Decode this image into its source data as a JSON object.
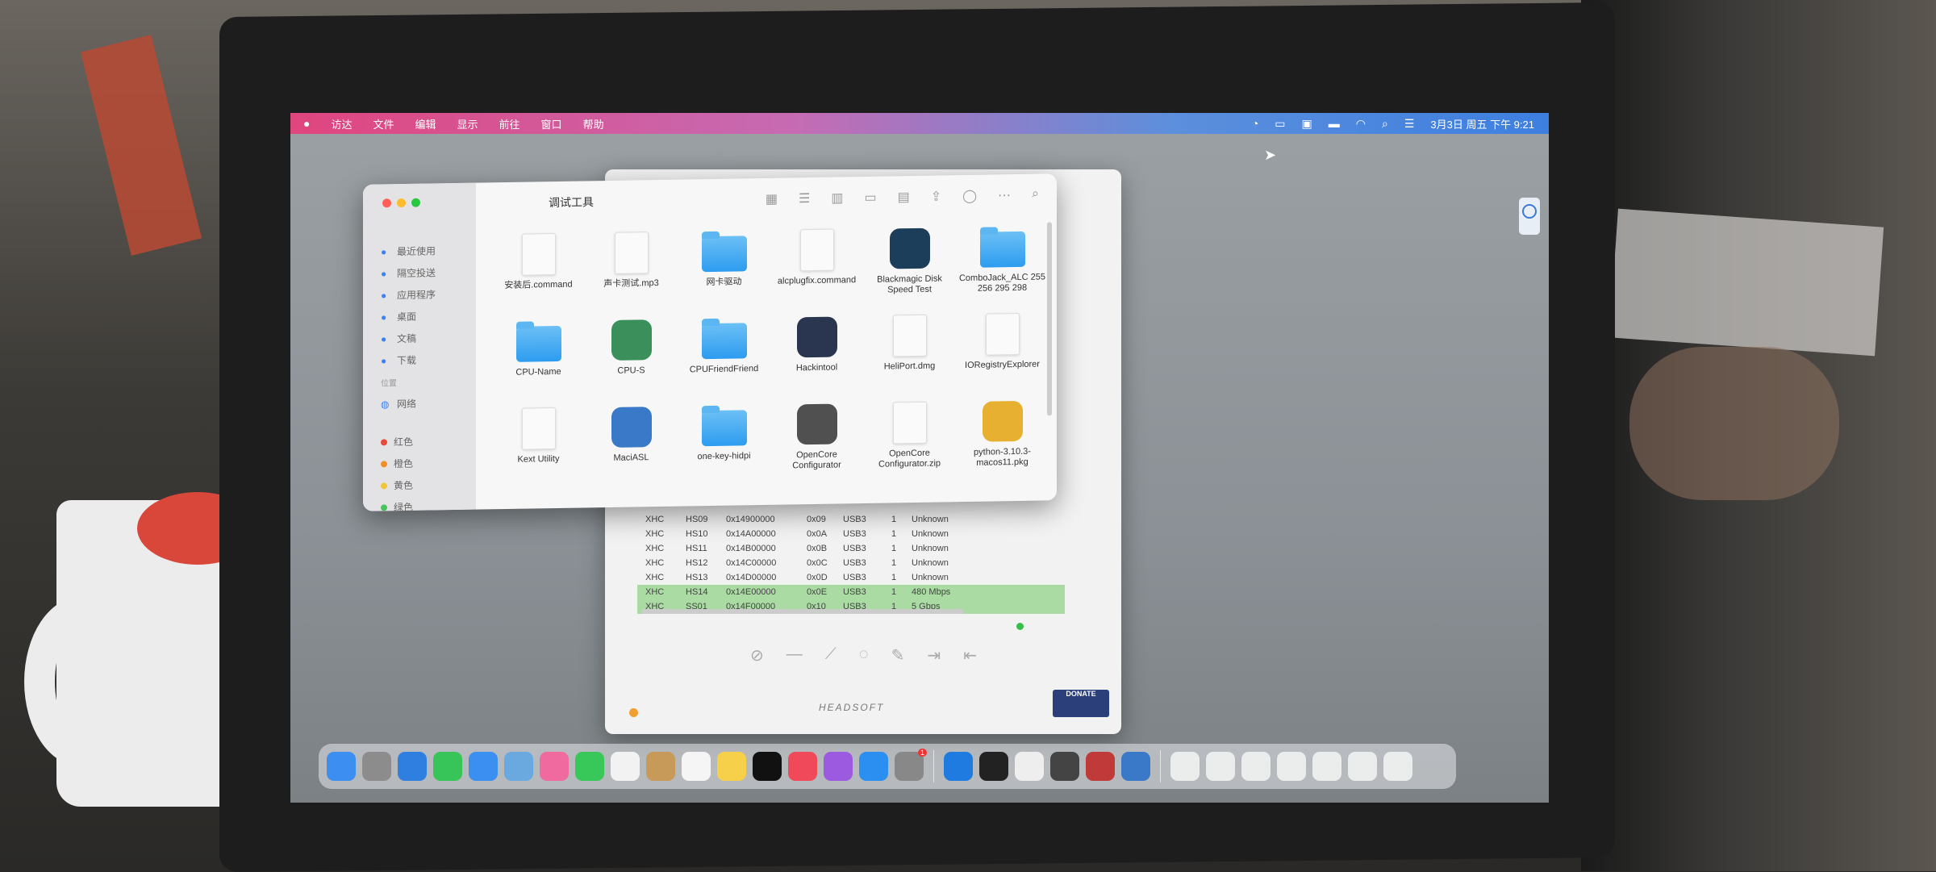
{
  "menubar": {
    "apple": "",
    "items": [
      "访达",
      "文件",
      "编辑",
      "显示",
      "前往",
      "窗口",
      "帮助"
    ],
    "clock": "3月3日 周五 下午 9:21"
  },
  "finder": {
    "title": "调试工具",
    "sidebar": [
      {
        "label": "最近使用",
        "icon": "clock-icon"
      },
      {
        "label": "隔空投送",
        "icon": "airdrop-icon"
      },
      {
        "label": "应用程序",
        "icon": "apps-icon"
      },
      {
        "label": "桌面",
        "icon": "desktop-icon"
      },
      {
        "label": "文稿",
        "icon": "doc-icon"
      },
      {
        "label": "下载",
        "icon": "download-icon"
      }
    ],
    "sidebar_section_location": "位置",
    "sidebar_network": "网络",
    "sidebar_tags": [
      {
        "label": "红色",
        "color": "#e64a3b"
      },
      {
        "label": "橙色",
        "color": "#f0902a"
      },
      {
        "label": "黄色",
        "color": "#f0c53a"
      },
      {
        "label": "绿色",
        "color": "#48c45a"
      }
    ],
    "files": [
      {
        "name": "安装后.command",
        "kind": "doc"
      },
      {
        "name": "声卡测试.mp3",
        "kind": "doc"
      },
      {
        "name": "网卡驱动",
        "kind": "folder"
      },
      {
        "name": "alcplugfix.command",
        "kind": "doc"
      },
      {
        "name": "Blackmagic Disk Speed Test",
        "kind": "app",
        "color": "#1d3e5a"
      },
      {
        "name": "ComboJack_ALC 255 256 295 298",
        "kind": "folder"
      },
      {
        "name": "CPU-Name",
        "kind": "folder"
      },
      {
        "name": "CPU-S",
        "kind": "app",
        "color": "#3a8f5a"
      },
      {
        "name": "CPUFriendFriend",
        "kind": "folder"
      },
      {
        "name": "Hackintool",
        "kind": "app",
        "color": "#2a3550"
      },
      {
        "name": "HeliPort.dmg",
        "kind": "doc"
      },
      {
        "name": "IORegistryExplorer",
        "kind": "doc"
      },
      {
        "name": "Kext Utility",
        "kind": "doc"
      },
      {
        "name": "MaciASL",
        "kind": "app",
        "color": "#3a78c8"
      },
      {
        "name": "one-key-hidpi",
        "kind": "folder"
      },
      {
        "name": "OpenCore Configurator",
        "kind": "app",
        "color": "#505050"
      },
      {
        "name": "OpenCore Configurator.zip",
        "kind": "doc"
      },
      {
        "name": "python-3.10.3-macos11.pkg",
        "kind": "app",
        "color": "#e8b030"
      }
    ]
  },
  "usb_table": [
    [
      "XHC",
      "HS09",
      "0x14900000",
      "0x09",
      "USB3",
      "1",
      "Unknown"
    ],
    [
      "XHC",
      "HS10",
      "0x14A00000",
      "0x0A",
      "USB3",
      "1",
      "Unknown"
    ],
    [
      "XHC",
      "HS11",
      "0x14B00000",
      "0x0B",
      "USB3",
      "1",
      "Unknown"
    ],
    [
      "XHC",
      "HS12",
      "0x14C00000",
      "0x0C",
      "USB3",
      "1",
      "Unknown"
    ],
    [
      "XHC",
      "HS13",
      "0x14D00000",
      "0x0D",
      "USB3",
      "1",
      "Unknown"
    ],
    [
      "XHC",
      "HS14",
      "0x14E00000",
      "0x0E",
      "USB3",
      "1",
      "480 Mbps"
    ],
    [
      "XHC",
      "SS01",
      "0x14F00000",
      "0x10",
      "USB3",
      "1",
      "5 Gbps"
    ]
  ],
  "usb_highlight_rows": [
    5,
    6
  ],
  "backwin": {
    "footer": "HEADSOFT",
    "donate": "DONATE"
  },
  "dock": {
    "badge": "1",
    "apps": [
      "finder-icon",
      "launchpad-icon",
      "safari-icon",
      "messages-icon",
      "mail-icon",
      "maps-icon",
      "photos-icon",
      "facetime-icon",
      "calendar-icon",
      "contacts-icon",
      "reminders-icon",
      "notes-icon",
      "tv-icon",
      "music-icon",
      "podcasts-icon",
      "appstore-icon",
      "settings-icon",
      "teamviewer-icon",
      "terminal-icon",
      "textedit-icon",
      "opencore-icon",
      "hackintool-icon",
      "maciasl-icon"
    ],
    "right": [
      "document-icon",
      "folder-icon",
      "folder-icon",
      "folder-icon",
      "folder-icon",
      "folder-icon",
      "trash-icon"
    ]
  }
}
